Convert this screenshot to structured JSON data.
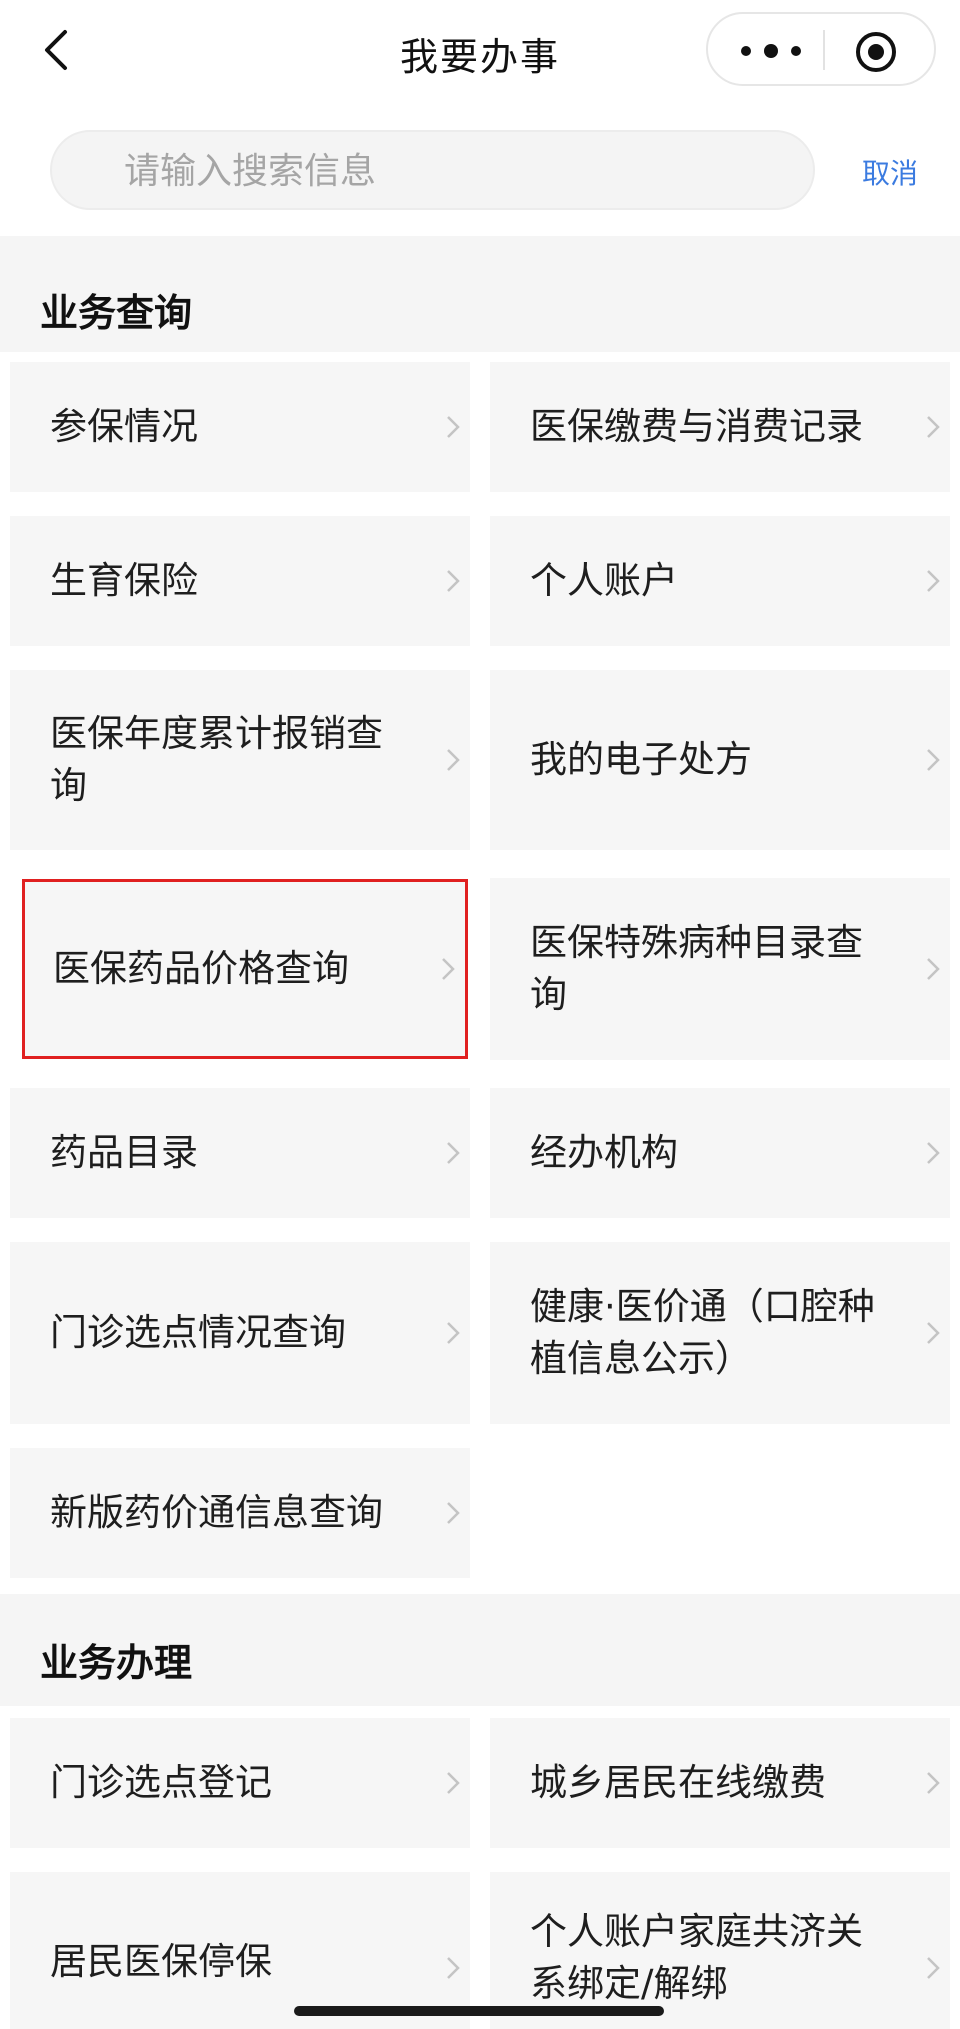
{
  "nav": {
    "title": "我要办事"
  },
  "search": {
    "placeholder": "请输入搜索信息",
    "cancel_label": "取消"
  },
  "sections": [
    {
      "title": "业务查询",
      "items": [
        "参保情况",
        "医保缴费与消费记录",
        "生育保险",
        "个人账户",
        "医保年度累计报销查询",
        "我的电子处方",
        "医保药品价格查询",
        "医保特殊病种目录查询",
        "药品目录",
        "经办机构",
        "门诊选点情况查询",
        "健康·医价通（口腔种植信息公示）",
        "新版药价通信息查询"
      ]
    },
    {
      "title": "业务办理",
      "items": [
        "门诊选点登记",
        "城乡居民在线缴费",
        "居民医保停保",
        "个人账户家庭共济关系绑定/解绑"
      ]
    }
  ],
  "highlighted_item": "医保药品价格查询",
  "colors": {
    "accent": "#3b7be0",
    "highlight_border": "#e02020",
    "card_bg": "#f6f6f6",
    "section_bg": "#f5f5f5"
  },
  "icons": [
    "back-icon",
    "more-icon",
    "target-icon",
    "chevron-right-icon"
  ]
}
